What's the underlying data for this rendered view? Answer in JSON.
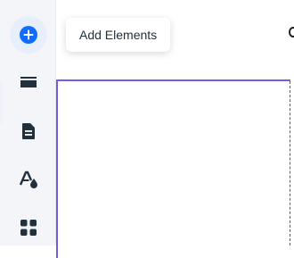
{
  "sidebar": {
    "items": [
      {
        "id": "add",
        "icon": "add-circle-icon",
        "active": true
      },
      {
        "id": "sections",
        "icon": "sections-icon"
      },
      {
        "id": "pages",
        "icon": "page-icon"
      },
      {
        "id": "design",
        "icon": "theme-icon"
      },
      {
        "id": "apps",
        "icon": "apps-grid-icon"
      }
    ]
  },
  "tooltip": {
    "label": "Add Elements"
  },
  "colors": {
    "accent_blue": "#116dff",
    "selection_purple": "#6e5ee8",
    "sidebar_bg": "#f4f5f8",
    "icon_dark": "#20303c"
  }
}
